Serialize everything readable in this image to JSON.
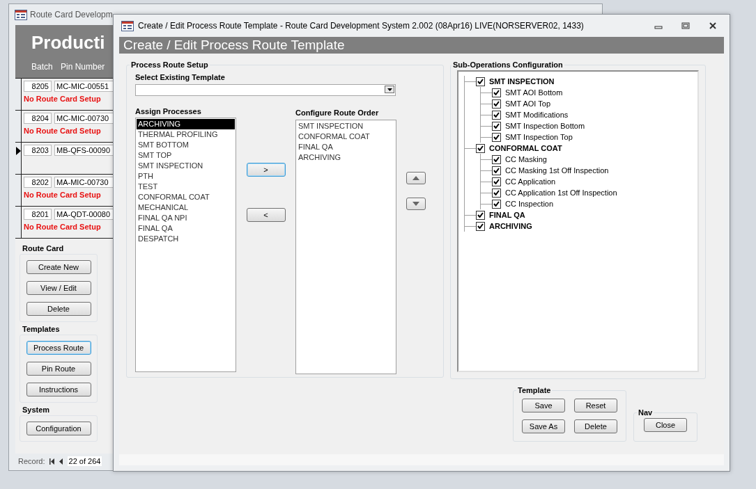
{
  "background_window": {
    "title": "Route Card Developm",
    "heading": "Producti",
    "columns": [
      "Batch",
      "Pin Number"
    ],
    "rows": [
      {
        "batch": "8205",
        "pin": "MC-MIC-00551",
        "warning": "No Route Card Setup",
        "current": false
      },
      {
        "batch": "8204",
        "pin": "MC-MIC-00730",
        "warning": "No Route Card Setup",
        "current": false
      },
      {
        "batch": "8203",
        "pin": "MB-QFS-00090",
        "current": true
      },
      {
        "batch": "8202",
        "pin": "MA-MIC-00730",
        "warning": "No Route Card Setup",
        "current": false
      },
      {
        "batch": "8201",
        "pin": "MA-QDT-00080",
        "warning": "No Route Card Setup",
        "current": false
      }
    ],
    "groups": [
      {
        "title": "Route Card",
        "buttons": [
          {
            "label": "Create New",
            "focused": false
          },
          {
            "label": "View / Edit",
            "focused": false
          },
          {
            "label": "Delete",
            "focused": false
          }
        ]
      },
      {
        "title": "Templates",
        "buttons": [
          {
            "label": "Process Route",
            "focused": true
          },
          {
            "label": "Pin Route",
            "focused": false
          },
          {
            "label": "Instructions",
            "focused": false
          }
        ]
      },
      {
        "title": "System",
        "buttons": [
          {
            "label": "Configuration",
            "focused": false
          }
        ]
      }
    ],
    "record_nav": {
      "label": "Record:",
      "position": "22 of 264"
    }
  },
  "dialog": {
    "title": "Create / Edit Process Route Template - Route Card Development System 2.002 (08Apr16) LIVE(NORSERVER02, 1433)",
    "heading": "Create / Edit Process Route Template",
    "setup": {
      "title": "Process Route Setup",
      "template_label": "Select Existing Template",
      "assign_label": "Assign Processes",
      "assign_items": [
        {
          "label": "ARCHIVING",
          "selected": true
        },
        {
          "label": "THERMAL PROFILING",
          "selected": false
        },
        {
          "label": "SMT BOTTOM",
          "selected": false
        },
        {
          "label": "SMT TOP",
          "selected": false
        },
        {
          "label": "SMT INSPECTION",
          "selected": false
        },
        {
          "label": "PTH",
          "selected": false
        },
        {
          "label": "TEST",
          "selected": false
        },
        {
          "label": "CONFORMAL COAT",
          "selected": false
        },
        {
          "label": "MECHANICAL",
          "selected": false
        },
        {
          "label": "FINAL QA NPI",
          "selected": false
        },
        {
          "label": "FINAL QA",
          "selected": false
        },
        {
          "label": "DESPATCH",
          "selected": false
        }
      ],
      "add_button": {
        "label": ">",
        "focused": true
      },
      "remove_button": {
        "label": "<",
        "focused": false
      },
      "order_label": "Configure Route Order",
      "order_items": [
        "SMT INSPECTION",
        "CONFORMAL COAT",
        "FINAL QA",
        "ARCHIVING"
      ]
    },
    "sub_ops": {
      "title": "Sub-Operations Configuration",
      "tree": [
        {
          "label": "SMT INSPECTION",
          "checked": true,
          "children": [
            {
              "label": "SMT AOI Bottom",
              "checked": true
            },
            {
              "label": "SMT AOI Top",
              "checked": true
            },
            {
              "label": "SMT Modifications",
              "checked": true
            },
            {
              "label": "SMT Inspection Bottom",
              "checked": true
            },
            {
              "label": "SMT Inspection Top",
              "checked": true
            }
          ]
        },
        {
          "label": "CONFORMAL COAT",
          "checked": true,
          "children": [
            {
              "label": "CC Masking",
              "checked": true
            },
            {
              "label": "CC Masking 1st Off Inspection",
              "checked": true
            },
            {
              "label": "CC Application",
              "checked": true
            },
            {
              "label": "CC Application 1st Off Inspection",
              "checked": true
            },
            {
              "label": "CC Inspection",
              "checked": true
            }
          ]
        },
        {
          "label": "FINAL QA",
          "checked": true
        },
        {
          "label": "ARCHIVING",
          "checked": true
        }
      ]
    },
    "template_group": {
      "title": "Template",
      "buttons": [
        "Save",
        "Reset",
        "Save As",
        "Delete"
      ]
    },
    "nav_group": {
      "title": "Nav",
      "buttons": [
        "Close"
      ]
    }
  }
}
